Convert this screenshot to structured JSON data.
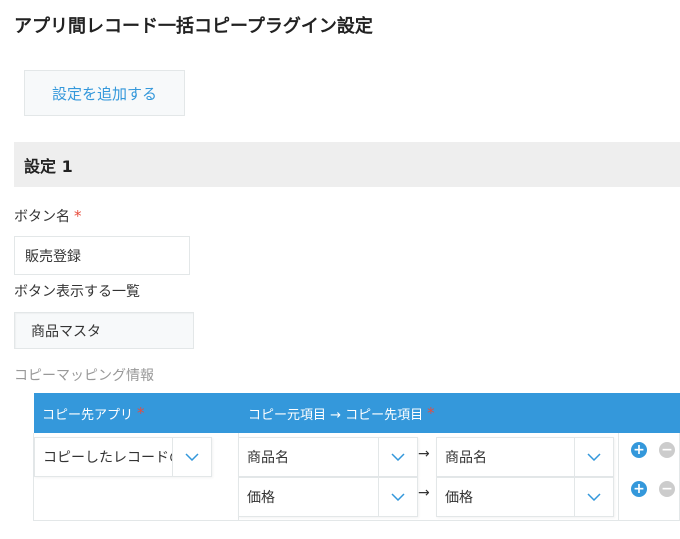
{
  "page": {
    "title": "アプリ間レコード一括コピープラグイン設定",
    "add_setting_label": "設定を追加する"
  },
  "setting": {
    "header": "設定 1",
    "button_name_label": "ボタン名",
    "required_mark": "*",
    "button_name_value": "販売登録",
    "display_list_label": "ボタン表示する一覧",
    "display_list_value": "商品マスタ",
    "mapping_section_label": "コピーマッピング情報"
  },
  "mapping_table": {
    "col_dest_app": "コピー先アプリ",
    "col_fields": "コピー元項目 → コピー先項目",
    "dest_app_value": "コピーしたレコードの",
    "arrow": "→",
    "add_symbol": "+",
    "remove_symbol": "−",
    "rows": [
      {
        "source_field": "商品名",
        "dest_field": "商品名"
      },
      {
        "source_field": "価格",
        "dest_field": "価格"
      }
    ]
  },
  "colors": {
    "accent": "#3498db",
    "required": "#e74c3c",
    "header_bg": "#eeeeee",
    "remove_icon": "#cccccc"
  },
  "icons": [
    "chevron-down-icon",
    "plus-circle-icon",
    "minus-circle-icon",
    "arrow-right-icon"
  ]
}
